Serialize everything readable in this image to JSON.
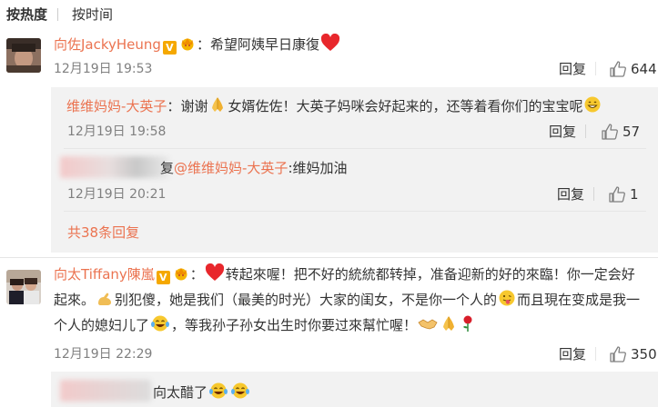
{
  "sort": {
    "hot": "按热度",
    "time": "按时间"
  },
  "comments": [
    {
      "user": "向佐JackyHeung",
      "sep": "：",
      "text": "希望阿姨早日康復",
      "time": "12月19日 19:53",
      "reply_label": "回复",
      "likes": "644",
      "replies": [
        {
          "user": "维维妈妈-大英子",
          "sep": "：",
          "text_a": "谢谢",
          "text_b": "女婿佐佐！大英子妈咪会好起来的，还等着看你们的宝宝呢",
          "time": "12月19日 19:58",
          "reply_label": "回复",
          "likes": "57"
        },
        {
          "user_prefix": "复",
          "mention": "@维维妈妈-大英子",
          "text": ":维妈加油",
          "time": "12月19日 20:21",
          "reply_label": "回复",
          "likes": "1"
        }
      ],
      "more": "共38条回复"
    },
    {
      "user": "向太Tiffany陳嵐",
      "sep": "：",
      "line1_a": "转起來喔！把不好的統統都转掉，准备迎新的好的來臨！你一定会好",
      "line2_a": "起來。",
      "line2_b": "别犯傻，她是我们（最美的时光）大家的闺女，不是你一个人的",
      "line2_c": "而且現在变成是我一",
      "line3_a": "个人的媳妇儿了",
      "line3_b": "，等我孙子孙女出生时你要过來幫忙喔！",
      "time": "12月19日 22:29",
      "reply_label": "回复",
      "likes": "350",
      "replies": [
        {
          "text": "向太醋了"
        }
      ]
    }
  ],
  "colors": {
    "name": "#eb7350",
    "meta": "#808080",
    "reply_bg": "#f2f2f2",
    "badge": "#f5a800"
  }
}
